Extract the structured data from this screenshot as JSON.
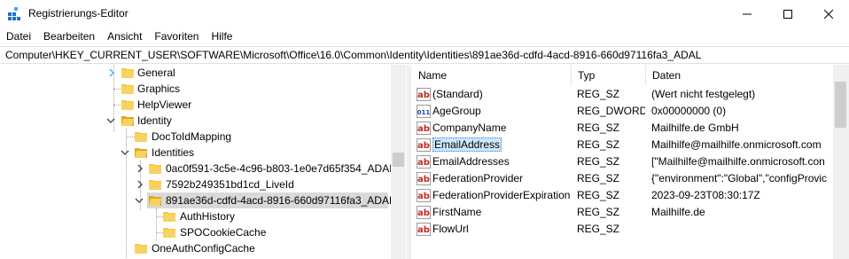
{
  "window": {
    "title": "Registrierungs-Editor",
    "icons": [
      "registry-app-icon",
      "minimize-icon",
      "maximize-icon",
      "close-icon"
    ]
  },
  "menu": [
    "Datei",
    "Bearbeiten",
    "Ansicht",
    "Favoriten",
    "Hilfe"
  ],
  "address": "Computer\\HKEY_CURRENT_USER\\SOFTWARE\\Microsoft\\Office\\16.0\\Common\\Identity\\Identities\\891ae36d-cdfd-4acd-8916-660d97116fa3_ADAL",
  "tree": {
    "items": [
      {
        "label": "General",
        "expander": "collapsed"
      },
      {
        "label": "Graphics",
        "expander": "none"
      },
      {
        "label": "HelpViewer",
        "expander": "none"
      },
      {
        "label": "Identity",
        "expander": "expanded"
      },
      {
        "label": "DocToIdMapping",
        "expander": "none"
      },
      {
        "label": "Identities",
        "expander": "expanded"
      },
      {
        "label": "0ac0f591-3c5e-4c96-b803-1e0e7d65f354_ADAL",
        "expander": "collapsed"
      },
      {
        "label": "7592b249351bd1cd_LiveId",
        "expander": "collapsed"
      },
      {
        "label": "891ae36d-cdfd-4acd-8916-660d97116fa3_ADAL",
        "expander": "expanded",
        "selected": true
      },
      {
        "label": "AuthHistory",
        "expander": "none"
      },
      {
        "label": "SPOCookieCache",
        "expander": "none"
      },
      {
        "label": "OneAuthConfigCache",
        "expander": "none"
      }
    ]
  },
  "list": {
    "headers": {
      "name": "Name",
      "type": "Typ",
      "data": "Daten"
    },
    "rows": [
      {
        "icon": "string-value-icon",
        "name": "(Standard)",
        "type": "REG_SZ",
        "data": "(Wert nicht festgelegt)"
      },
      {
        "icon": "binary-value-icon",
        "name": "AgeGroup",
        "type": "REG_DWORD",
        "data": "0x00000000 (0)"
      },
      {
        "icon": "string-value-icon",
        "name": "CompanyName",
        "type": "REG_SZ",
        "data": "Mailhilfe.de GmbH"
      },
      {
        "icon": "string-value-icon",
        "name": "EmailAddress",
        "type": "REG_SZ",
        "data": "Mailhilfe@mailhilfe.onmicrosoft.com",
        "selected": true
      },
      {
        "icon": "string-value-icon",
        "name": "EmailAddresses",
        "type": "REG_SZ",
        "data": "[\"Mailhilfe@mailhilfe.onmicrosoft.con"
      },
      {
        "icon": "string-value-icon",
        "name": "FederationProvider",
        "type": "REG_SZ",
        "data": "{\"environment\":\"Global\",\"configProvic"
      },
      {
        "icon": "string-value-icon",
        "name": "FederationProviderExpiration",
        "type": "REG_SZ",
        "data": "2023-09-23T08:30:17Z"
      },
      {
        "icon": "string-value-icon",
        "name": "FirstName",
        "type": "REG_SZ",
        "data": "Mailhilfe.de"
      },
      {
        "icon": "string-value-icon",
        "name": "FlowUrl",
        "type": "REG_SZ",
        "data": ""
      }
    ]
  },
  "colors": {
    "folder": "#f5c542",
    "folder_dark": "#e0a526",
    "selection_focus": "#cce8ff",
    "tree_selected": "#d9d9d9",
    "string_icon_red": "#c62828",
    "binary_icon_blue": "#1e3fa0"
  }
}
